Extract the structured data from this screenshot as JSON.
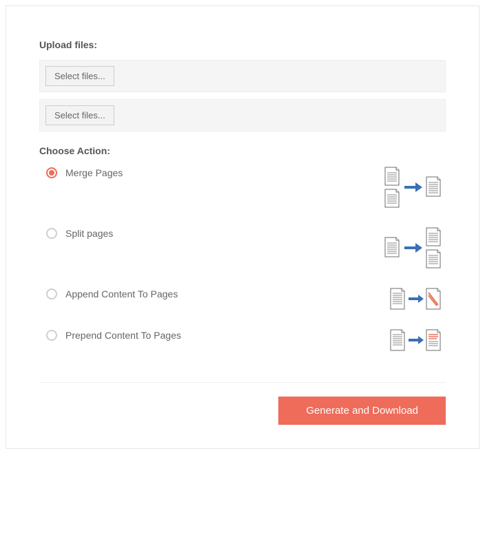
{
  "upload": {
    "heading": "Upload files:",
    "select1_label": "Select files...",
    "select2_label": "Select files..."
  },
  "choose": {
    "heading": "Choose Action:",
    "options": [
      {
        "label": "Merge Pages",
        "checked": true
      },
      {
        "label": "Split pages",
        "checked": false
      },
      {
        "label": "Append Content To Pages",
        "checked": false
      },
      {
        "label": "Prepend Content To Pages",
        "checked": false
      }
    ]
  },
  "footer": {
    "submit_label": "Generate and Download"
  },
  "colors": {
    "accent": "#ef6b5a",
    "arrow": "#3a6fb7",
    "doc_stroke": "#6b6b6b"
  }
}
